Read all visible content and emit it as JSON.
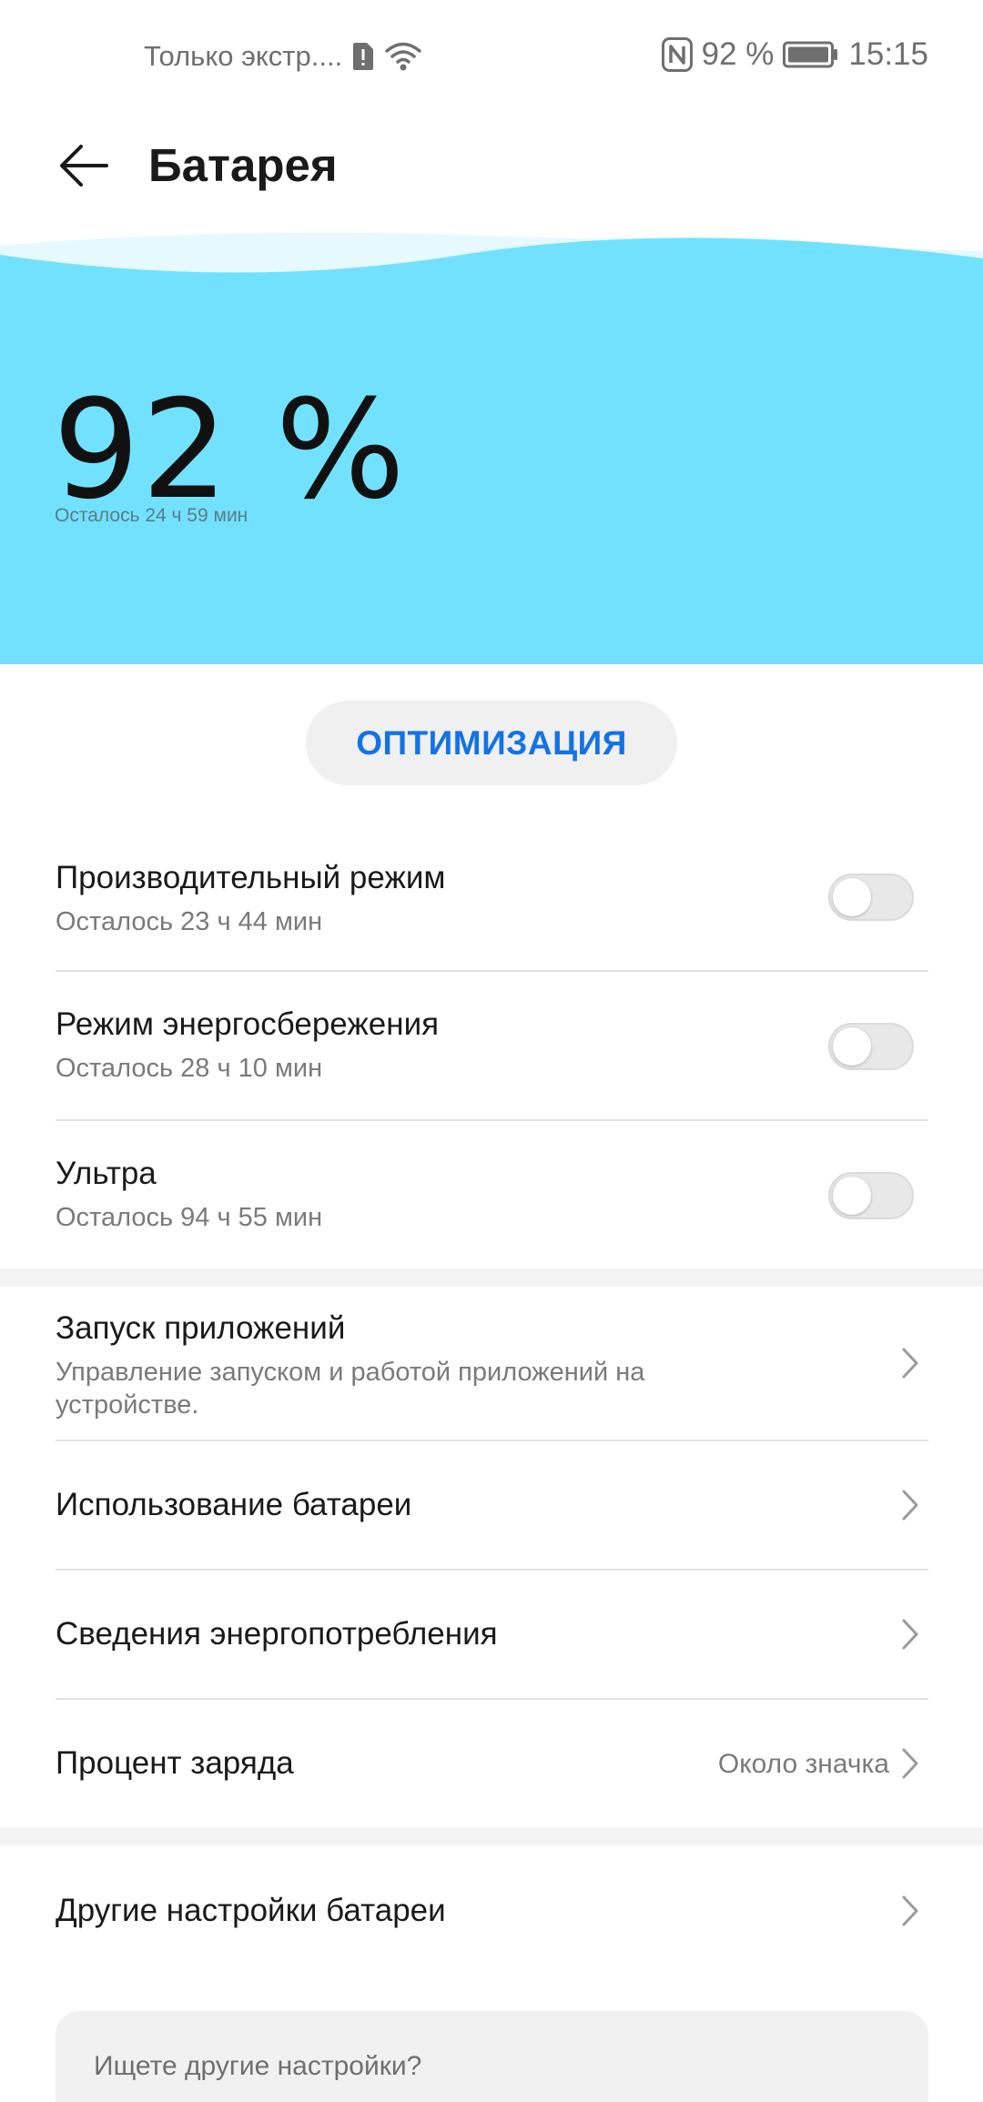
{
  "status_bar": {
    "carrier": "Только экстр....",
    "battery_percent": "92 %",
    "time": "15:15",
    "icons": [
      "sim-alert-icon",
      "wifi-icon",
      "nfc-icon",
      "battery-icon"
    ]
  },
  "header": {
    "title": "Батарея",
    "back_icon": "arrow-left-icon"
  },
  "battery": {
    "percent": "92 %",
    "remaining": "Осталось 24 ч 59 мин",
    "level": 0.92,
    "accent_color": "#72e1fd"
  },
  "optimize": {
    "label": "ОПТИМИЗАЦИЯ",
    "color": "#1273e6"
  },
  "modes": [
    {
      "title": "Производительный режим",
      "subtitle": "Осталось 23 ч 44 мин",
      "enabled": false
    },
    {
      "title": "Режим энергосбережения",
      "subtitle": "Осталось 28 ч 10 мин",
      "enabled": false
    },
    {
      "title": "Ультра",
      "subtitle": "Осталось 94 ч 55 мин",
      "enabled": false
    }
  ],
  "settings": [
    {
      "title": "Запуск приложений",
      "subtitle": "Управление запуском и работой приложений на устройстве."
    },
    {
      "title": "Использование батареи"
    },
    {
      "title": "Сведения энергопотребления"
    },
    {
      "title": "Процент заряда",
      "value": "Около значка"
    }
  ],
  "other": {
    "title": "Другие настройки батареи"
  },
  "search_card": {
    "text": "Ищете другие настройки?"
  }
}
